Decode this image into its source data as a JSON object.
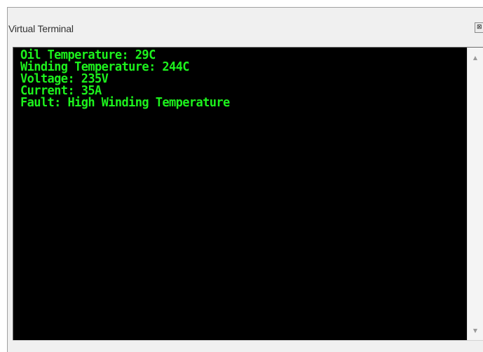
{
  "window": {
    "title": "Virtual Terminal",
    "close_glyph": "⊠"
  },
  "terminal": {
    "text_color": "#1df21d",
    "background_color": "#000000",
    "lines": [
      "Oil Temperature: 29C",
      "Winding Temperature: 244C",
      "Voltage: 235V",
      "Current: 35A",
      "Fault: High Winding Temperature"
    ]
  },
  "scrollbar": {
    "up_glyph": "▲",
    "down_glyph": "▼"
  }
}
